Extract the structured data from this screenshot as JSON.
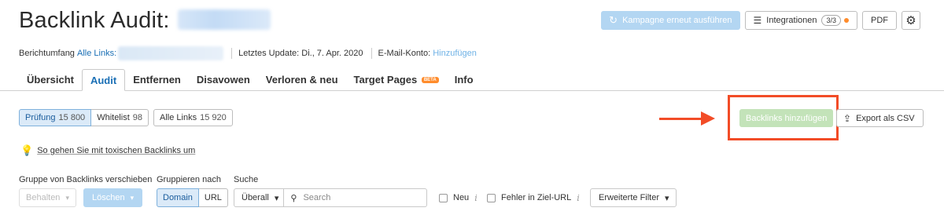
{
  "header": {
    "title": "Backlink Audit:",
    "actions": {
      "campaign_label": "Kampagne erneut ausführen",
      "integrations_label": "Integrationen",
      "integrations_count": "3/3",
      "pdf_label": "PDF",
      "campaign_icon": "refresh-icon",
      "integrations_icon": "integrations-icon",
      "settings_icon": "gear-icon"
    }
  },
  "meta": {
    "scope_label": "Berichtumfang",
    "scope_link": "Alle Links:",
    "last_update": "Letztes Update: Di., 7. Apr. 2020",
    "email_label": "E-Mail-Konto:",
    "email_link": "Hinzufügen"
  },
  "tabs": [
    {
      "label": "Übersicht"
    },
    {
      "label": "Audit",
      "active": true
    },
    {
      "label": "Entfernen"
    },
    {
      "label": "Disavowen"
    },
    {
      "label": "Verloren & neu"
    },
    {
      "label": "Target Pages",
      "badge": "BETA"
    },
    {
      "label": "Info"
    }
  ],
  "filters": {
    "pruefung": {
      "label": "Prüfung",
      "count": "15 800"
    },
    "whitelist": {
      "label": "Whitelist",
      "count": "98"
    },
    "alle_links": {
      "label": "Alle Links",
      "count": "15 920"
    }
  },
  "actions": {
    "add_backlinks": "Backlinks hinzufügen",
    "export_csv": "Export als CSV",
    "export_icon": "export-icon"
  },
  "hint": {
    "text": "So gehen Sie mit toxischen Backlinks um",
    "icon": "lightbulb-icon"
  },
  "controls": {
    "move_group_label": "Gruppe von Backlinks verschieben",
    "keep_label": "Behalten",
    "delete_label": "Löschen",
    "group_by_label": "Gruppieren nach",
    "group_domain": "Domain",
    "group_url": "URL",
    "search_label": "Suche",
    "scope_select": "Überall",
    "search_placeholder": "Search",
    "new_label": "Neu",
    "target_error_label": "Fehler in Ziel-URL",
    "advanced_filter": "Erweiterte Filter"
  },
  "colors": {
    "accent_blue": "#1a6fb5",
    "highlight_red": "#f24c27",
    "add_button_green": "#c3e3b9",
    "beta_orange": "#ff8c2c"
  }
}
